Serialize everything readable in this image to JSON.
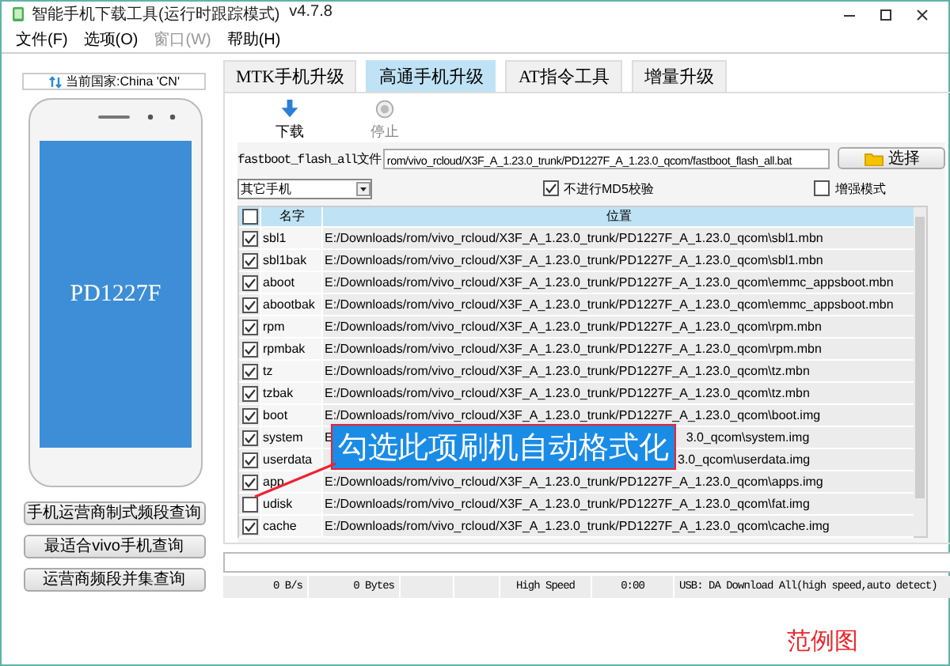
{
  "window": {
    "title": "智能手机下载工具(运行时跟踪模式)",
    "version": "v4.7.8"
  },
  "menu": [
    {
      "label": "文件(F)",
      "disabled": false
    },
    {
      "label": "选项(O)",
      "disabled": false
    },
    {
      "label": "窗口(W)",
      "disabled": true
    },
    {
      "label": "帮助(H)",
      "disabled": false
    }
  ],
  "side_panel": {
    "country": "当前国家:China 'CN'",
    "phone_model": "PD1227F",
    "buttons": [
      "手机运营商制式频段查询",
      "最适合vivo手机查询",
      "运营商频段并集查询"
    ]
  },
  "tabs": [
    {
      "label": "MTK手机升级",
      "selected": false
    },
    {
      "label": "高通手机升级",
      "selected": true
    },
    {
      "label": "AT指令工具",
      "selected": false
    },
    {
      "label": "增量升级",
      "selected": false
    }
  ],
  "toolbar": [
    {
      "kind": "download",
      "label": "下载",
      "disabled": false
    },
    {
      "kind": "stop",
      "label": "停止",
      "disabled": true
    }
  ],
  "file_row": {
    "label": "fastboot_flash_all文件",
    "value": "rom/vivo_rcloud/X3F_A_1.23.0_trunk/PD1227F_A_1.23.0_qcom/fastboot_flash_all.bat",
    "button": "选择"
  },
  "phone_type": {
    "value": "其它手机"
  },
  "options": [
    {
      "label": "不进行MD5校验",
      "checked": true
    },
    {
      "label": "增强模式",
      "checked": false
    }
  ],
  "table": {
    "all_checked": false,
    "columns": [
      "名字",
      "位置"
    ],
    "rows": [
      {
        "checked": true,
        "name": "sbl1",
        "location": [
          {
            "kind": "start",
            "text": "E:/Downloads/rom/vivo_rcloud/X3F_A_1.23.0_trunk/PD1227F_A_1.23.0_qcom\\sbl1.mbn"
          }
        ]
      },
      {
        "checked": true,
        "name": "sbl1bak",
        "location": [
          {
            "kind": "start",
            "text": "E:/Downloads/rom/vivo_rcloud/X3F_A_1.23.0_trunk/PD1227F_A_1.23.0_qcom\\sbl1.mbn"
          }
        ]
      },
      {
        "checked": true,
        "name": "aboot",
        "location": [
          {
            "kind": "start",
            "text": "E:/Downloads/rom/vivo_rcloud/X3F_A_1.23.0_trunk/PD1227F_A_1.23.0_qcom\\emmc_appsboot.mbn"
          }
        ]
      },
      {
        "checked": true,
        "name": "abootbak",
        "location": [
          {
            "kind": "start",
            "text": "E:/Downloads/rom/vivo_rcloud/X3F_A_1.23.0_trunk/PD1227F_A_1.23.0_qcom\\emmc_appsboot.mbn"
          }
        ]
      },
      {
        "checked": true,
        "name": "rpm",
        "location": [
          {
            "kind": "start",
            "text": "E:/Downloads/rom/vivo_rcloud/X3F_A_1.23.0_trunk/PD1227F_A_1.23.0_qcom\\rpm.mbn"
          }
        ]
      },
      {
        "checked": true,
        "name": "rpmbak",
        "location": [
          {
            "kind": "start",
            "text": "E:/Downloads/rom/vivo_rcloud/X3F_A_1.23.0_trunk/PD1227F_A_1.23.0_qcom\\rpm.mbn"
          }
        ]
      },
      {
        "checked": true,
        "name": "tz",
        "location": [
          {
            "kind": "start",
            "text": "E:/Downloads/rom/vivo_rcloud/X3F_A_1.23.0_trunk/PD1227F_A_1.23.0_qcom\\tz.mbn"
          }
        ]
      },
      {
        "checked": true,
        "name": "tzbak",
        "location": [
          {
            "kind": "start",
            "text": "E:/Downloads/rom/vivo_rcloud/X3F_A_1.23.0_trunk/PD1227F_A_1.23.0_qcom\\tz.mbn"
          }
        ]
      },
      {
        "checked": true,
        "name": "boot",
        "location": [
          {
            "kind": "start",
            "text": "E:/Downloads/rom/vivo_rcloud/X3F_A_1.23.0_trunk/PD1227F_A_1.23.0_qcom\\boot.img"
          }
        ]
      },
      {
        "checked": true,
        "name": "system",
        "location": [
          {
            "kind": "start",
            "text": "E"
          },
          {
            "kind": "end",
            "text": "3.0_qcom\\system.img"
          }
        ]
      },
      {
        "checked": true,
        "name": "userdata",
        "location": [
          {
            "kind": "end",
            "text": "3.0_qcom\\userdata.img"
          }
        ]
      },
      {
        "checked": true,
        "name": "app",
        "location": [
          {
            "kind": "start",
            "text": "E:/Downloads/rom/vivo_rcloud/X3F_A_1.23.0_trunk/PD1227F_A_1.23.0_qcom\\apps.img"
          }
        ]
      },
      {
        "checked": false,
        "name": "udisk",
        "location": [
          {
            "kind": "start",
            "text": "E:/Downloads/rom/vivo_rcloud/X3F_A_1.23.0_trunk/PD1227F_A_1.23.0_qcom\\fat.img"
          }
        ]
      },
      {
        "checked": true,
        "name": "cache",
        "location": [
          {
            "kind": "start",
            "text": "E:/Downloads/rom/vivo_rcloud/X3F_A_1.23.0_trunk/PD1227F_A_1.23.0_qcom\\cache.img"
          }
        ]
      }
    ]
  },
  "progress": {
    "level": 0
  },
  "status_bar": [
    "0 B/s",
    "0 Bytes",
    "High Speed",
    "0:00",
    "USB: DA Download All(high speed,auto detect)"
  ],
  "callout": {
    "text": "勾选此项刷机自动格式化"
  },
  "caption": "范例图"
}
